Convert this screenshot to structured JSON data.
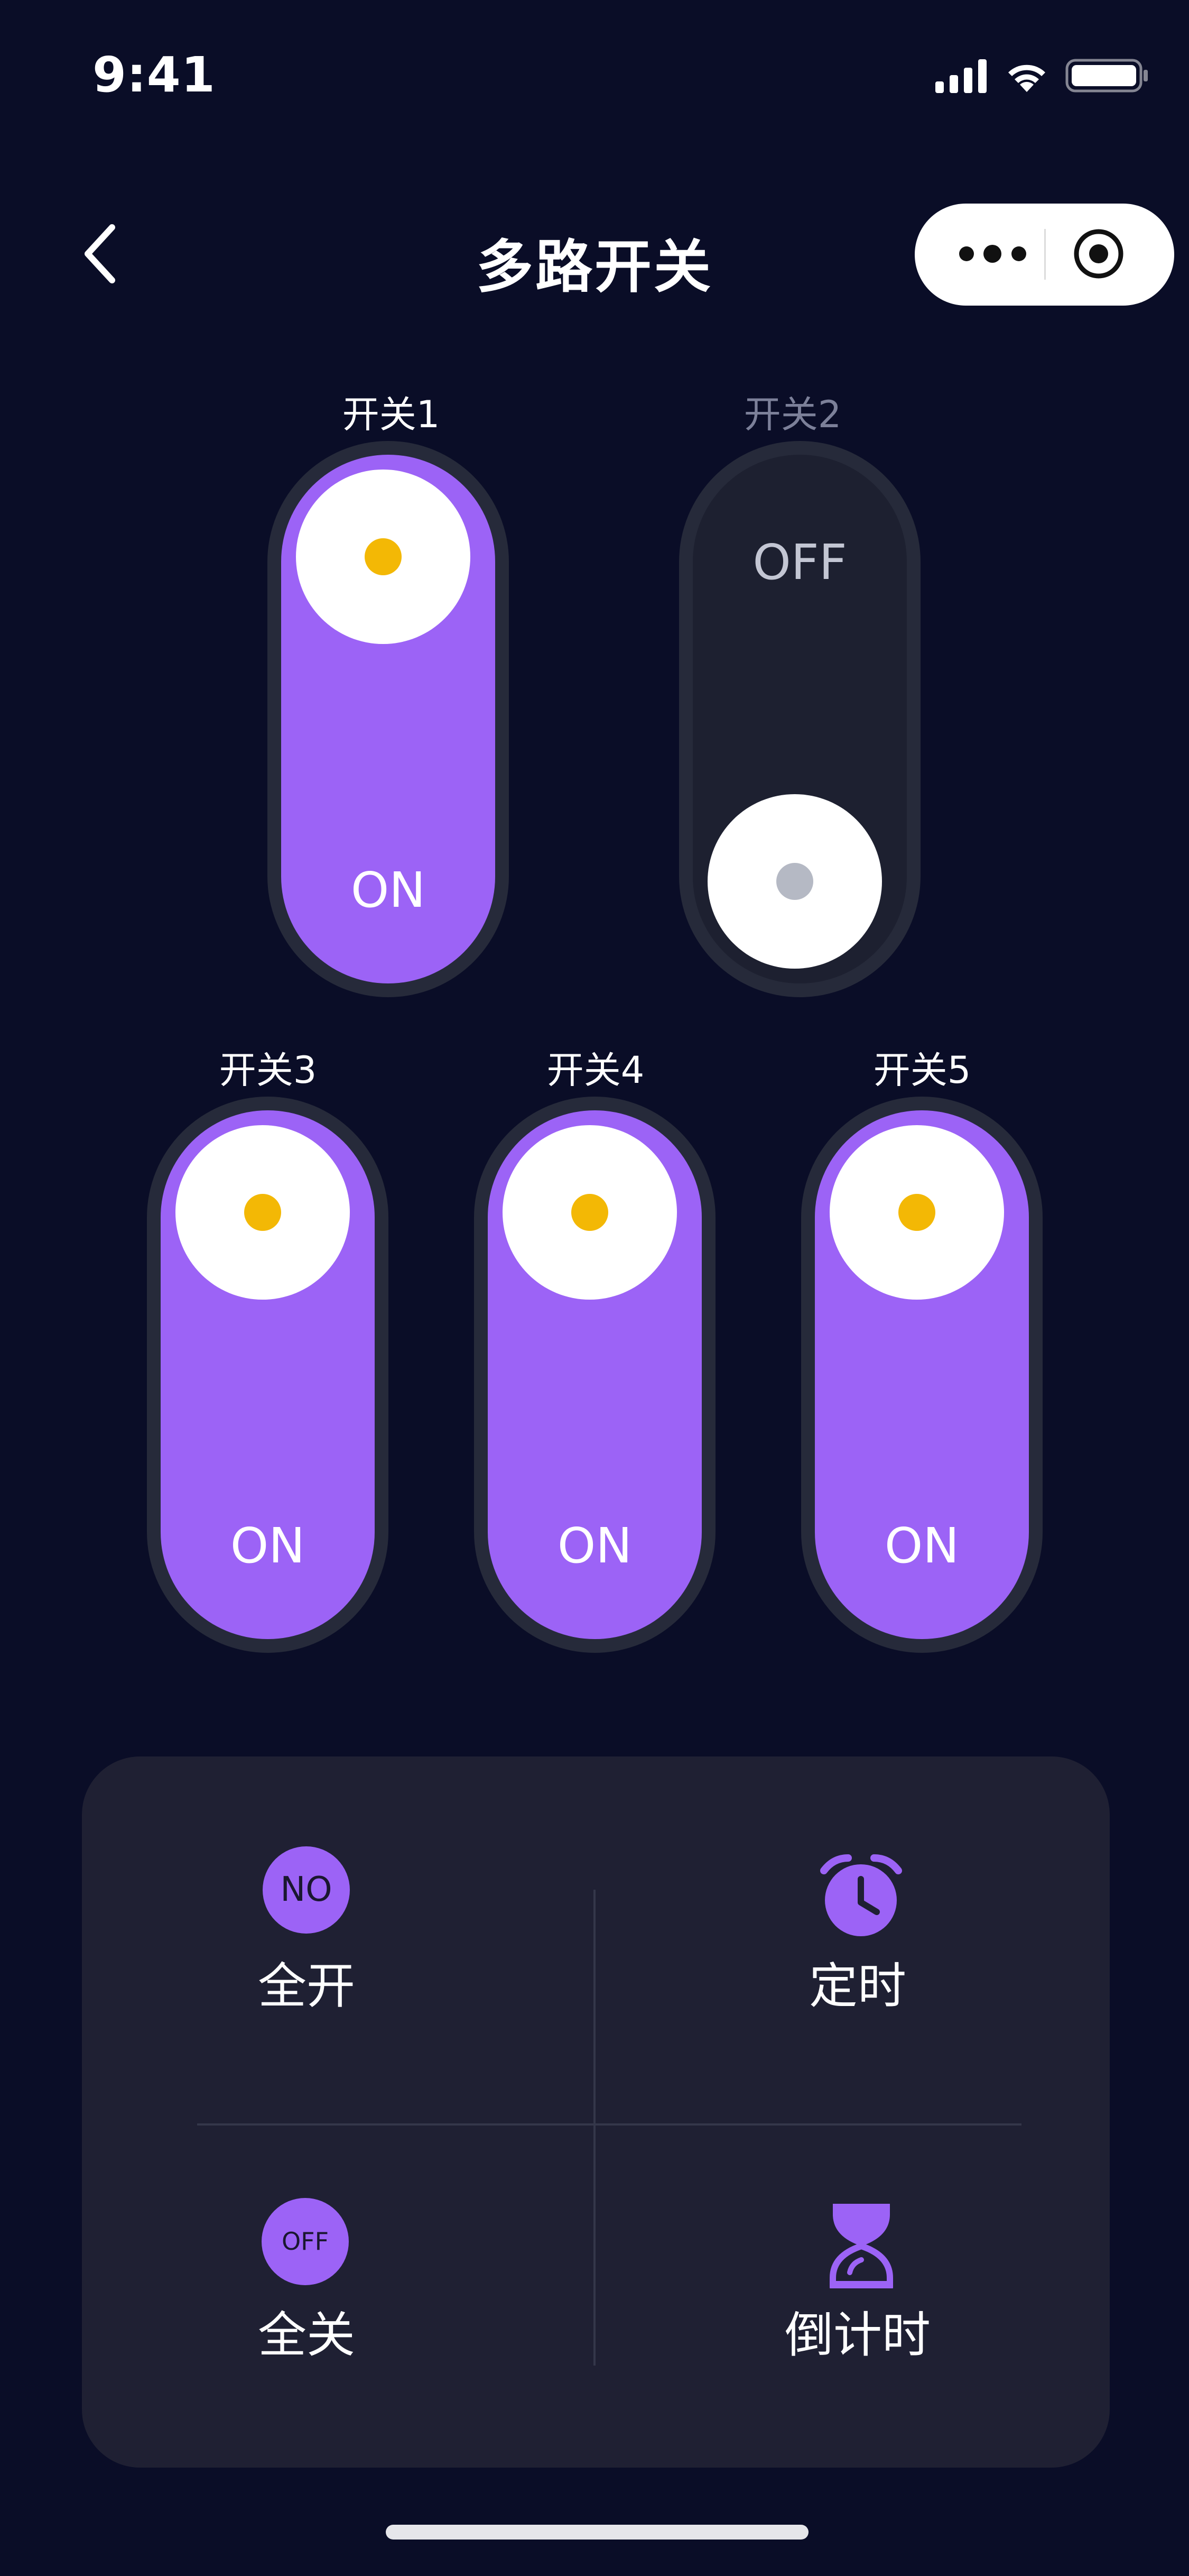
{
  "status_bar": {
    "time": "9:41"
  },
  "nav": {
    "title": "多路开关"
  },
  "switches": [
    {
      "label": "开关1",
      "state": "ON"
    },
    {
      "label": "开关2",
      "state": "OFF"
    },
    {
      "label": "开关3",
      "state": "ON"
    },
    {
      "label": "开关4",
      "state": "ON"
    },
    {
      "label": "开关5",
      "state": "ON"
    }
  ],
  "actions": {
    "all_on": {
      "badge": "NO",
      "label": "全开"
    },
    "timer": {
      "label": "定时"
    },
    "all_off": {
      "badge": "OFF",
      "label": "全关"
    },
    "countdown": {
      "label": "倒计时"
    }
  },
  "colors": {
    "background": "#0a0d27",
    "accent": "#9c63f6",
    "knob_dot_on": "#f3b805",
    "card": "#1f2033"
  },
  "icons": {
    "back": "chevron-left-icon",
    "more": "more-dots-icon",
    "record": "target-icon",
    "timer": "alarm-clock-icon",
    "countdown": "hourglass-icon"
  }
}
